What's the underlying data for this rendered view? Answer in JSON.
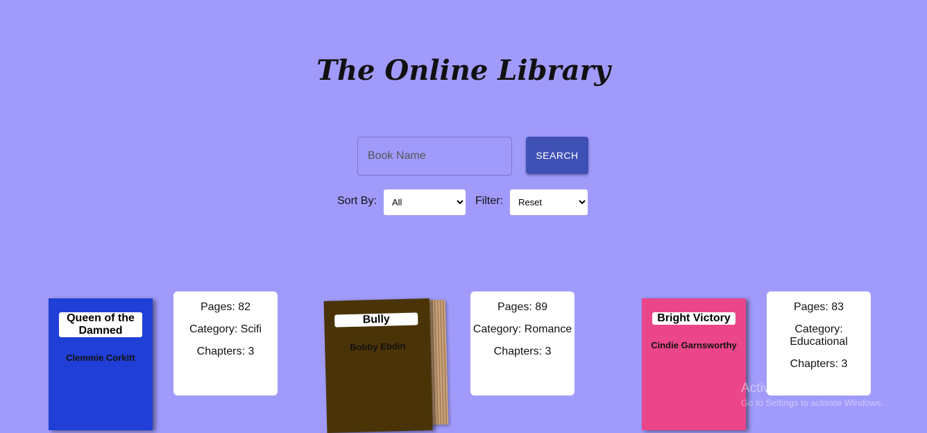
{
  "header": {
    "title": "The Online Library"
  },
  "search": {
    "placeholder": "Book Name",
    "button_label": "SEARCH"
  },
  "controls": {
    "sort_label": "Sort By:",
    "sort_value": "All",
    "filter_label": "Filter:",
    "filter_value": "Reset"
  },
  "books": [
    {
      "title": "Queen of the Damned",
      "author": "Clemmie Corkitt",
      "cover_color": "#1f3fd6",
      "pages": "Pages: 82",
      "category": "Category: Scifi",
      "chapters": "Chapters: 3"
    },
    {
      "title": "Bully",
      "author": "Bobby Ebdin",
      "cover_color": "#4a3407",
      "pages": "Pages: 89",
      "category": "Category: Romance",
      "chapters": "Chapters: 3"
    },
    {
      "title": "Bright Victory",
      "author": "Cindie Garnsworthy",
      "cover_color": "#ec468a",
      "pages": "Pages: 83",
      "category": "Category: Educational",
      "chapters": "Chapters: 3"
    }
  ],
  "watermark": {
    "line1": "Activate Windows",
    "line2": "Go to Settings to activate Windows."
  }
}
